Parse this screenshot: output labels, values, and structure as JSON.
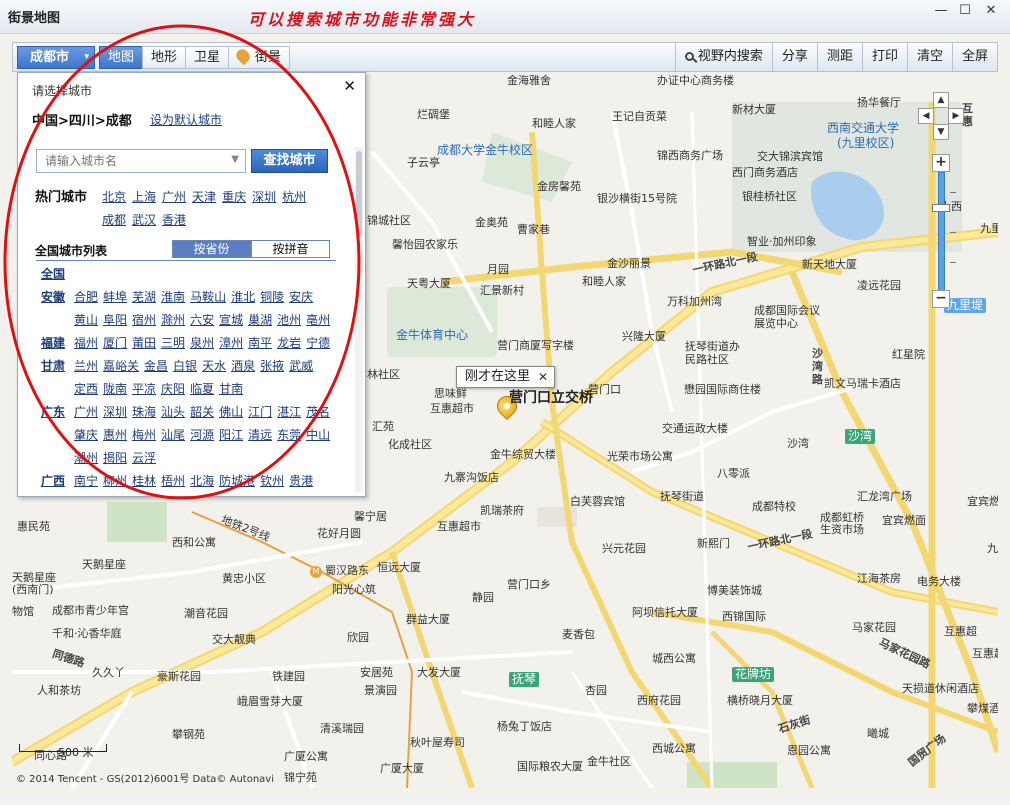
{
  "window": {
    "title": "街景地图",
    "slogan": "可以搜索城市功能非常强大",
    "min": "—",
    "max": "☐",
    "close": "✕"
  },
  "toolbar": {
    "city": "成都市",
    "city_chevron": "▾",
    "map_tabs": [
      "地图",
      "地形",
      "卫星",
      "街景"
    ],
    "right_tools": [
      "视野内搜索",
      "分享",
      "测距",
      "打印",
      "清空",
      "全屏"
    ]
  },
  "city_panel": {
    "title": "请选择城市",
    "close": "✕",
    "breadcrumb": "中国>四川>成都",
    "set_default": "设为默认城市",
    "search_placeholder": "请输入城市名",
    "search_button": "查找城市",
    "hot_label": "热门城市",
    "hot_cities": [
      "北京",
      "上海",
      "广州",
      "天津",
      "重庆",
      "深圳",
      "杭州",
      "成都",
      "武汉",
      "香港"
    ],
    "all_label": "全国城市列表",
    "tabs": [
      "按省份",
      "按拼音"
    ],
    "provinces": [
      {
        "name": "全国",
        "cities": []
      },
      {
        "name": "安徽",
        "cities": [
          "合肥",
          "蚌埠",
          "芜湖",
          "淮南",
          "马鞍山",
          "淮北",
          "铜陵",
          "安庆",
          "黄山",
          "阜阳",
          "宿州",
          "滁州",
          "六安",
          "宣城",
          "巢湖",
          "池州",
          "亳州"
        ]
      },
      {
        "name": "福建",
        "cities": [
          "福州",
          "厦门",
          "莆田",
          "三明",
          "泉州",
          "漳州",
          "南平",
          "龙岩",
          "宁德"
        ]
      },
      {
        "name": "甘肃",
        "cities": [
          "兰州",
          "嘉峪关",
          "金昌",
          "白银",
          "天水",
          "酒泉",
          "张掖",
          "武威",
          "定西",
          "陇南",
          "平凉",
          "庆阳",
          "临夏",
          "甘南"
        ]
      },
      {
        "name": "广东",
        "cities": [
          "广州",
          "深圳",
          "珠海",
          "汕头",
          "韶关",
          "佛山",
          "江门",
          "湛江",
          "茂名",
          "肇庆",
          "惠州",
          "梅州",
          "汕尾",
          "河源",
          "阳江",
          "清远",
          "东莞",
          "中山",
          "潮州",
          "揭阳",
          "云浮"
        ]
      },
      {
        "name": "广西",
        "cities": [
          "南宁",
          "柳州",
          "桂林",
          "梧州",
          "北海",
          "防城港",
          "钦州",
          "贵港"
        ]
      }
    ]
  },
  "map": {
    "callout": "刚才在这里",
    "callout_close": "✕",
    "marker_label": "营门口立交桥",
    "scale": "500 米",
    "copyright": "© 2014 Tencent - GS(2012)6001号 Data© Autonavi",
    "labels": [
      {
        "t": "金海雅舍",
        "k": "poi"
      },
      {
        "t": "办证中心商务楼",
        "k": "poi"
      },
      {
        "t": "扬华餐厅",
        "k": "poi"
      },
      {
        "t": "烂碉堡",
        "k": "plain"
      },
      {
        "t": "新材大厦",
        "k": "poi"
      },
      {
        "t": "和睦人家",
        "k": "poi"
      },
      {
        "t": "王记自贡菜",
        "k": "poi"
      },
      {
        "t": "西南交通大学",
        "k": "blue"
      },
      {
        "t": "(九里校区)",
        "k": "blue"
      },
      {
        "t": "成都大学金牛校区",
        "k": "blue"
      },
      {
        "t": "锦西商务广场",
        "k": "poi"
      },
      {
        "t": "交大锦滨宾馆",
        "k": "plain"
      },
      {
        "t": "子云亭",
        "k": "plain"
      },
      {
        "t": "西门商务酒店",
        "k": "poi"
      },
      {
        "t": "金房馨苑",
        "k": "poi"
      },
      {
        "t": "银桂桥社区",
        "k": "poi"
      },
      {
        "t": "银沙横街15号院",
        "k": "plain"
      },
      {
        "t": "锦城社区",
        "k": "plain"
      },
      {
        "t": "金奥苑",
        "k": "plain"
      },
      {
        "t": "曹家巷",
        "k": "plain"
      },
      {
        "t": "馨怡园农家乐",
        "k": "poi"
      },
      {
        "t": "智业·加州印象",
        "k": "poi"
      },
      {
        "t": "月园",
        "k": "poi"
      },
      {
        "t": "金沙丽景",
        "k": "poi"
      },
      {
        "t": "一环路北一段",
        "k": "road"
      },
      {
        "t": "新天地大厦",
        "k": "poi"
      },
      {
        "t": "天粤大厦",
        "k": "poi"
      },
      {
        "t": "汇景新村",
        "k": "plain"
      },
      {
        "t": "和睦人家",
        "k": "poi"
      },
      {
        "t": "凌远花园",
        "k": "poi"
      },
      {
        "t": "万科加州湾",
        "k": "poi"
      },
      {
        "t": "九里堤",
        "k": "hlb"
      },
      {
        "t": "成都国际会议",
        "k": "plain"
      },
      {
        "t": "展览中心",
        "k": "plain"
      },
      {
        "t": "金牛体育中心",
        "k": "blue"
      },
      {
        "t": "营门商厦写字楼",
        "k": "plain"
      },
      {
        "t": "兴隆大厦",
        "k": "poi"
      },
      {
        "t": "抚琴街道办",
        "k": "plain"
      },
      {
        "t": "民路社区",
        "k": "plain"
      },
      {
        "t": "沙湾路",
        "k": "road"
      },
      {
        "t": "红星院",
        "k": "poi"
      },
      {
        "t": "林社区",
        "k": "plain"
      },
      {
        "t": "思味鲜",
        "k": "poi"
      },
      {
        "t": "营门口",
        "k": "plain"
      },
      {
        "t": "懋园国际商住楼",
        "k": "plain"
      },
      {
        "t": "凯文马瑞卡酒店",
        "k": "poi"
      },
      {
        "t": "互惠超市",
        "k": "plain"
      },
      {
        "t": "汇苑",
        "k": "plain"
      },
      {
        "t": "交通运政大楼",
        "k": "poi"
      },
      {
        "t": "沙湾",
        "k": "plain"
      },
      {
        "t": "沙湾",
        "k": "hl"
      },
      {
        "t": "化成社区",
        "k": "poi"
      },
      {
        "t": "金牛综贸大楼",
        "k": "poi"
      },
      {
        "t": "光荣市场公寓",
        "k": "poi"
      },
      {
        "t": "八零派",
        "k": "poi"
      },
      {
        "t": "九寨沟饭店",
        "k": "poi"
      },
      {
        "t": "汇龙湾广场",
        "k": "poi"
      },
      {
        "t": "白芙蓉宾馆",
        "k": "plain"
      },
      {
        "t": "抚琴街道",
        "k": "plain"
      },
      {
        "t": "成都特校",
        "k": "poi"
      },
      {
        "t": "宜宾燃",
        "k": "poi"
      },
      {
        "t": "惠民苑",
        "k": "poi"
      },
      {
        "t": "馨宁居",
        "k": "poi"
      },
      {
        "t": "凯瑞茶府",
        "k": "plain"
      },
      {
        "t": "宜宾燃面",
        "k": "poi"
      },
      {
        "t": "成都虹桥",
        "k": "plain"
      },
      {
        "t": "生资市场",
        "k": "plain"
      },
      {
        "t": "地铁2号线",
        "k": "plain"
      },
      {
        "t": "花好月圆",
        "k": "poi"
      },
      {
        "t": "互惠超市",
        "k": "poi"
      },
      {
        "t": "西和公寓",
        "k": "poi"
      },
      {
        "t": "兴元花园",
        "k": "poi"
      },
      {
        "t": "新熙门",
        "k": "poi"
      },
      {
        "t": "一环路北一段",
        "k": "road"
      },
      {
        "t": "天鹅星座",
        "k": "poi"
      },
      {
        "t": "恒远大厦",
        "k": "poi"
      },
      {
        "t": "蜀汉路东",
        "k": "metro"
      },
      {
        "t": "天鹅星座",
        "k": "plain"
      },
      {
        "t": "(西南门)",
        "k": "plain"
      },
      {
        "t": "黄忠小区",
        "k": "poi"
      },
      {
        "t": "营门口乡",
        "k": "plain"
      },
      {
        "t": "江海茶房",
        "k": "poi"
      },
      {
        "t": "电务大楼",
        "k": "poi"
      },
      {
        "t": "阳光心筑",
        "k": "poi"
      },
      {
        "t": "博美装饰城",
        "k": "poi"
      },
      {
        "t": "物馆",
        "k": "plain"
      },
      {
        "t": "成都市青少年宫",
        "k": "plain"
      },
      {
        "t": "潮音花园",
        "k": "poi"
      },
      {
        "t": "静园",
        "k": "poi"
      },
      {
        "t": "群益大厦",
        "k": "poi"
      },
      {
        "t": "阿坝信托大厦",
        "k": "poi"
      },
      {
        "t": "西锦国际",
        "k": "poi"
      },
      {
        "t": "千和·沁香华庭",
        "k": "poi"
      },
      {
        "t": "交大靓典",
        "k": "poi"
      },
      {
        "t": "欣园",
        "k": "poi"
      },
      {
        "t": "麦香包",
        "k": "poi"
      },
      {
        "t": "马家花园",
        "k": "poi"
      },
      {
        "t": "互惠超",
        "k": "poi"
      },
      {
        "t": "同德路",
        "k": "road"
      },
      {
        "t": "久久丫",
        "k": "plain"
      },
      {
        "t": "城西公寓",
        "k": "poi"
      },
      {
        "t": "马家花园路",
        "k": "road"
      },
      {
        "t": "人和茶坊",
        "k": "poi"
      },
      {
        "t": "豪斯花园",
        "k": "poi"
      },
      {
        "t": "铁建园",
        "k": "poi"
      },
      {
        "t": "安居苑",
        "k": "plain"
      },
      {
        "t": "大发大厦",
        "k": "plain"
      },
      {
        "t": "花牌坊",
        "k": "hl"
      },
      {
        "t": "抚琴",
        "k": "hl"
      },
      {
        "t": "杏园",
        "k": "poi"
      },
      {
        "t": "西府花园",
        "k": "plain"
      },
      {
        "t": "横桥晓月大厦",
        "k": "poi"
      },
      {
        "t": "天损道休闲酒店",
        "k": "plain"
      },
      {
        "t": "峨眉雪芽大厦",
        "k": "poi"
      },
      {
        "t": "景演园",
        "k": "poi"
      },
      {
        "t": "清溪瑞园",
        "k": "poi"
      },
      {
        "t": "杨兔丁饭店",
        "k": "poi"
      },
      {
        "t": "石灰街",
        "k": "road"
      },
      {
        "t": "曦城",
        "k": "poi"
      },
      {
        "t": "攀钢苑",
        "k": "poi"
      },
      {
        "t": "秋叶屋寿司",
        "k": "poi"
      },
      {
        "t": "广厦公寓",
        "k": "poi"
      },
      {
        "t": "西城公寓",
        "k": "poi"
      },
      {
        "t": "恩园公寓",
        "k": "poi"
      },
      {
        "t": "国贸广场",
        "k": "poi"
      },
      {
        "t": "同心路",
        "k": "road"
      },
      {
        "t": "锦宁苑",
        "k": "plain"
      },
      {
        "t": "广厦大厦",
        "k": "poi"
      },
      {
        "t": "国际粮农大厦",
        "k": "poi"
      },
      {
        "t": "金牛社区",
        "k": "poi"
      },
      {
        "t": "攀煤酒店",
        "k": "poi"
      },
      {
        "t": "互惠超",
        "k": "poi"
      },
      {
        "t": "互惠",
        "k": "poi"
      },
      {
        "t": "九里堤中路",
        "k": "road"
      },
      {
        "t": "大西",
        "k": "plain"
      },
      {
        "t": "九里",
        "k": "plain"
      },
      {
        "t": "中",
        "k": "plain"
      }
    ]
  }
}
